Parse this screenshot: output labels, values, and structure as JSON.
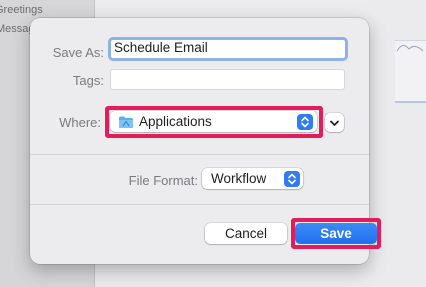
{
  "background": {
    "sidebar_items": [
      "Greetings",
      "Messages"
    ]
  },
  "dialog": {
    "save_as_label": "Save As:",
    "save_as_value": "Schedule Email",
    "tags_label": "Tags:",
    "tags_value": "",
    "where_label": "Where:",
    "where_value": "Applications",
    "where_icon": "folder-icon",
    "file_format_label": "File Format:",
    "file_format_value": "Workflow",
    "cancel_label": "Cancel",
    "save_label": "Save"
  },
  "colors": {
    "accent": "#2f7cf6",
    "highlight": "#e31d5c",
    "focus_ring": "#8fb2e6"
  }
}
